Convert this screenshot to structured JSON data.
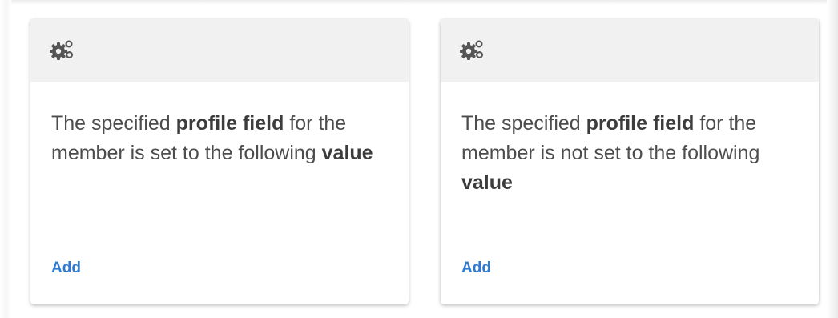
{
  "cards": [
    {
      "icon": "cogs-icon",
      "text_prefix": "The specified ",
      "text_bold1": "profile field",
      "text_middle": " for the member is set to the following ",
      "text_bold2": "value",
      "action_label": "Add"
    },
    {
      "icon": "cogs-icon",
      "text_prefix": "The specified ",
      "text_bold1": "profile field",
      "text_middle": " for the member is not set to the following ",
      "text_bold2": "value",
      "action_label": "Add"
    }
  ],
  "colors": {
    "header_bg": "#f1f1f1",
    "icon": "#555555",
    "text": "#4d4d4d",
    "link": "#2f7bd1"
  }
}
